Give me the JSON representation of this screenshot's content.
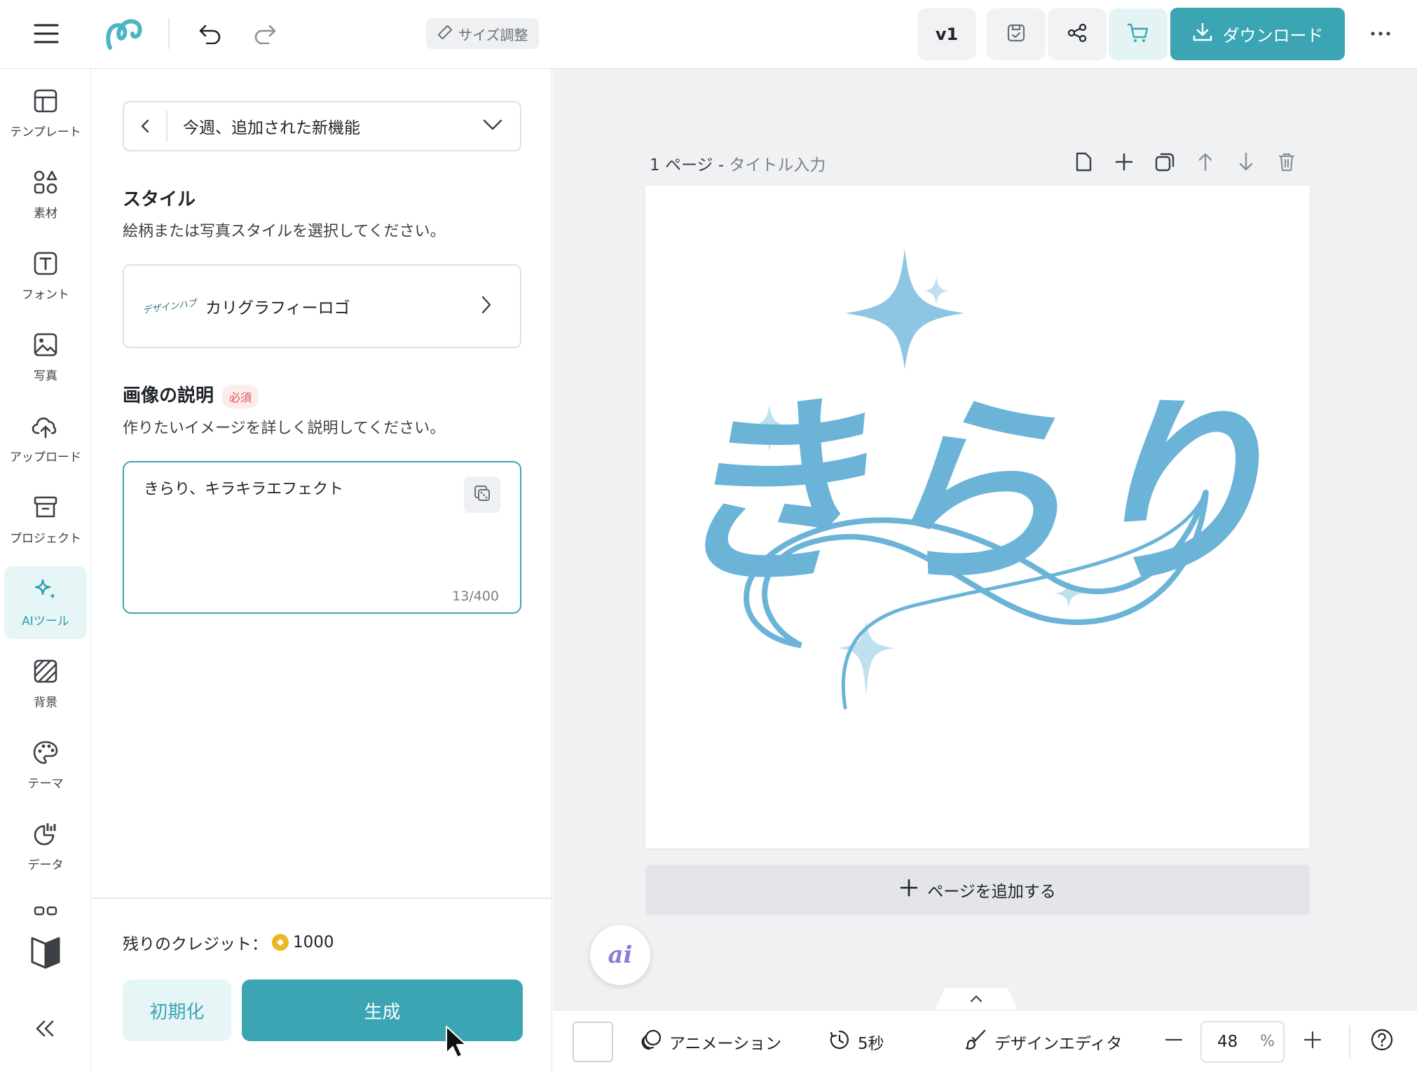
{
  "topbar": {
    "resize_label": "サイズ調整",
    "version_label": "v1",
    "download_label": "ダウンロード"
  },
  "rail": {
    "items": [
      {
        "label": "テンプレート",
        "icon": "template-icon"
      },
      {
        "label": "素材",
        "icon": "elements-icon"
      },
      {
        "label": "フォント",
        "icon": "font-icon"
      },
      {
        "label": "写真",
        "icon": "photo-icon"
      },
      {
        "label": "アップロード",
        "icon": "upload-icon"
      },
      {
        "label": "プロジェクト",
        "icon": "project-icon"
      },
      {
        "label": "AIツール",
        "icon": "sparkle-icon",
        "active": true
      },
      {
        "label": "背景",
        "icon": "background-icon"
      },
      {
        "label": "テーマ",
        "icon": "palette-icon"
      },
      {
        "label": "データ",
        "icon": "data-icon"
      }
    ]
  },
  "panel": {
    "nav_title": "今週、追加された新機能",
    "style_heading": "スタイル",
    "style_sub": "絵柄または写真スタイルを選択してください。",
    "style_thumb_text": "デザインハブ",
    "style_value": "カリグラフィーロゴ",
    "desc_heading": "画像の説明",
    "desc_required": "必須",
    "desc_sub": "作りたいイメージを詳しく説明してください。",
    "desc_value": "きらり、キラキラエフェクト",
    "desc_count": "13/400",
    "credits_label": "残りのクレジット：",
    "credits_value": "1000",
    "reset_label": "初期化",
    "generate_label": "生成"
  },
  "canvas": {
    "page_num": "1 ページ - ",
    "page_title_placeholder": "タイトル入力",
    "artwork_text": "きらり",
    "add_page_label": "ページを追加する",
    "ai_fab_label": "ai"
  },
  "bottombar": {
    "animation_label": "アニメーション",
    "duration_label": "5秒",
    "editor_label": "デザインエディタ",
    "zoom_value": "48",
    "zoom_unit": "%"
  },
  "colors": {
    "accent": "#3ba5b4",
    "accent_soft": "#e6f5f6",
    "artwork_blue": "#6bb4d8",
    "required_red": "#d9534f"
  }
}
